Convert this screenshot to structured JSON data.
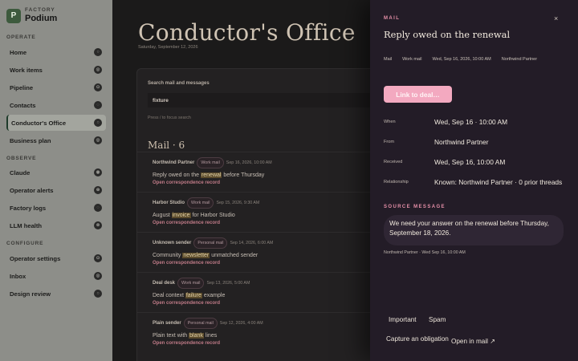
{
  "brand": {
    "kicker": "FACTORY",
    "name": "Podium",
    "logo_letter": "P"
  },
  "nav": {
    "sections": {
      "operate": "OPERATE",
      "observe": "OBSERVE",
      "configure": "CONFIGURE"
    },
    "items": [
      {
        "label": "Home",
        "glyph": "○"
      },
      {
        "label": "Work items",
        "glyph": "◎"
      },
      {
        "label": "Pipeline",
        "glyph": "⊙"
      },
      {
        "label": "Contacts",
        "glyph": "◌"
      },
      {
        "label": "Conductor's Office",
        "glyph": "○",
        "active": true
      },
      {
        "label": "Business plan",
        "glyph": "◎"
      },
      {
        "label": "Claude",
        "glyph": "◉"
      },
      {
        "label": "Operator alerts",
        "glyph": "⊕"
      },
      {
        "label": "Factory logs",
        "glyph": "◌"
      },
      {
        "label": "LLM health",
        "glyph": "⊗"
      },
      {
        "label": "Operator settings",
        "glyph": "⊙"
      },
      {
        "label": "Inbox",
        "glyph": "◎"
      },
      {
        "label": "Design review",
        "glyph": "○"
      }
    ]
  },
  "main": {
    "title": "Conductor's Office",
    "date": "Saturday, September 12, 2026",
    "search": {
      "label": "Search mail and messages",
      "value": "fixture",
      "hint": "Press / to focus search"
    },
    "mail_heading": "Mail · 6",
    "mail": [
      {
        "sender": "Northwind Partner",
        "tag": "Work mail",
        "time": "Sep 16, 2026, 10:00 AM",
        "subject_before": "Reply owed on the ",
        "subject_highlight": "renewal",
        "subject_after": " before Thursday",
        "link": "Open correspondence record"
      },
      {
        "sender": "Harbor Studio",
        "tag": "Work mail",
        "time": "Sep 15, 2026, 9:30 AM",
        "subject_before": "August ",
        "subject_highlight": "invoice",
        "subject_after": " for Harbor Studio",
        "link": "Open correspondence record"
      },
      {
        "sender": "Unknown sender",
        "tag": "Personal mail",
        "time": "Sep 14, 2026, 6:00 AM",
        "subject_before": "Community ",
        "subject_highlight": "newsletter",
        "subject_after": " unmatched sender",
        "link": "Open correspondence record"
      },
      {
        "sender": "Deal desk",
        "tag": "Work mail",
        "time": "Sep 13, 2026, 5:00 AM",
        "subject_before": "Deal context ",
        "subject_highlight": "failure",
        "subject_after": " example",
        "link": "Open correspondence record"
      },
      {
        "sender": "Plain sender",
        "tag": "Personal mail",
        "time": "Sep 12, 2026, 4:00 AM",
        "subject_before": "Plain text with ",
        "subject_highlight": "blank",
        "subject_after": " lines",
        "link": "Open correspondence record"
      }
    ]
  },
  "drawer": {
    "kicker": "MAIL",
    "close": "×",
    "title": "Reply owed on the renewal",
    "chips": [
      "Mail",
      "Work mail",
      "Wed, Sep 16, 2026, 10:00 AM",
      "Northwind Partner"
    ],
    "primary_button": "Link to deal…",
    "fields": [
      {
        "label": "When",
        "value": "Wed, Sep 16 · 10:00 AM"
      },
      {
        "label": "From",
        "value": "Northwind Partner"
      },
      {
        "label": "Received",
        "value": "Wed, Sep 16, 10:00 AM"
      },
      {
        "label": "Relationship",
        "value": "Known: Northwind Partner · 0 prior threads"
      }
    ],
    "source_heading": "SOURCE MESSAGE",
    "source_text": "We need your answer on the renewal before Thursday, September 18, 2026.",
    "source_meta": "Northwind Partner · Wed Sep 16, 10:00 AM",
    "actions": {
      "important": "Important",
      "spam": "Spam",
      "capture": "Capture an obligation",
      "open_mail": "Open in mail ↗"
    }
  }
}
